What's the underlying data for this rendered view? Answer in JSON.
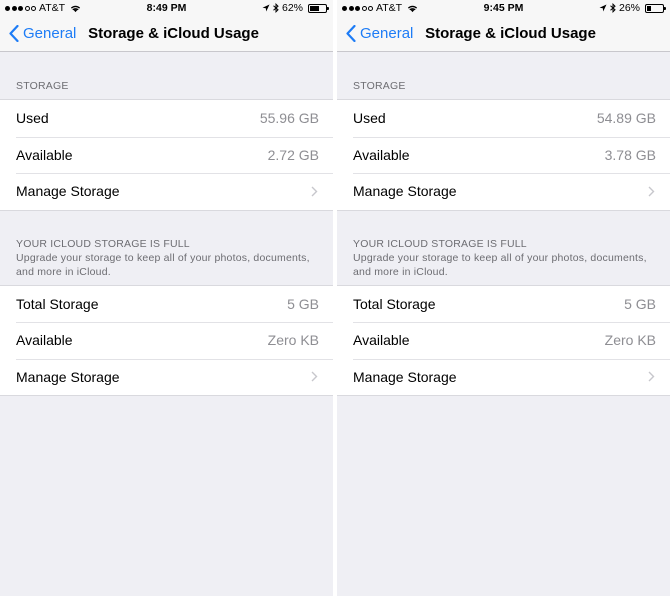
{
  "screens": [
    {
      "status": {
        "carrier": "AT&T",
        "time": "8:49 PM",
        "battery": "62%",
        "battery_fraction": 0.62
      },
      "nav": {
        "back_label": "General",
        "title": "Storage & iCloud Usage"
      },
      "storage": {
        "header": "STORAGE",
        "rows": [
          {
            "label": "Used",
            "value": "55.96 GB"
          },
          {
            "label": "Available",
            "value": "2.72 GB"
          },
          {
            "label": "Manage Storage"
          }
        ]
      },
      "icloud": {
        "header": "YOUR ICLOUD STORAGE IS FULL",
        "subtitle": "Upgrade your storage to keep all of your photos, documents, and more in iCloud.",
        "rows": [
          {
            "label": "Total Storage",
            "value": "5 GB"
          },
          {
            "label": "Available",
            "value": "Zero KB"
          },
          {
            "label": "Manage Storage"
          }
        ]
      }
    },
    {
      "status": {
        "carrier": "AT&T",
        "time": "9:45 PM",
        "battery": "26%",
        "battery_fraction": 0.26
      },
      "nav": {
        "back_label": "General",
        "title": "Storage & iCloud Usage"
      },
      "storage": {
        "header": "STORAGE",
        "rows": [
          {
            "label": "Used",
            "value": "54.89 GB"
          },
          {
            "label": "Available",
            "value": "3.78 GB"
          },
          {
            "label": "Manage Storage"
          }
        ]
      },
      "icloud": {
        "header": "YOUR ICLOUD STORAGE IS FULL",
        "subtitle": "Upgrade your storage to keep all of your photos, documents, and more in iCloud.",
        "rows": [
          {
            "label": "Total Storage",
            "value": "5 GB"
          },
          {
            "label": "Available",
            "value": "Zero KB"
          },
          {
            "label": "Manage Storage"
          }
        ]
      }
    }
  ],
  "icons": {
    "signal": "signal-dots-icon",
    "wifi": "wifi-icon",
    "location": "location-arrow-icon",
    "bluetooth": "bluetooth-icon",
    "battery": "battery-icon",
    "back": "chevron-left-icon",
    "disclosure": "chevron-right-icon"
  },
  "colors": {
    "accent": "#1d7cf6",
    "background": "#efeff4",
    "secondary_text": "#8e8e93"
  }
}
